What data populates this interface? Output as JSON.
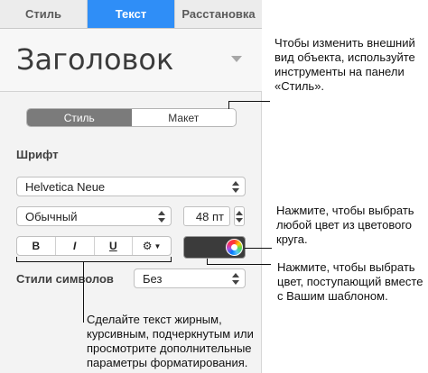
{
  "tabs": [
    {
      "label": "Стиль",
      "active": false
    },
    {
      "label": "Текст",
      "active": true
    },
    {
      "label": "Расстановка",
      "active": false
    }
  ],
  "paragraph_style": {
    "value": "Заголовок"
  },
  "segment": [
    {
      "label": "Стиль",
      "selected": true
    },
    {
      "label": "Макет",
      "selected": false
    }
  ],
  "font": {
    "label": "Шрифт",
    "family": "Helvetica Neue",
    "typeface": "Обычный",
    "size": "48 пт"
  },
  "format_buttons": {
    "bold": "B",
    "italic": "I",
    "underline": "U"
  },
  "text_color": {
    "color": "#3b3b3b"
  },
  "char_styles": {
    "label": "Стили символов",
    "value": "Без"
  },
  "callouts": {
    "style": "Чтобы изменить внешний вид объекта, используйте инструменты на панели «Стиль».",
    "color_wheel": "Нажмите, чтобы выбрать любой цвет из цветового круга.",
    "template_color": "Нажмите, чтобы выбрать цвет, поступающий вместе с Вашим шаблоном.",
    "formatting": "Сделайте текст жирным, курсивным, подчеркнутым или просмотрите дополнительные параметры форматирования."
  },
  "colors": {
    "accent": "#2f8ef7",
    "panel": "#f3f3f3"
  }
}
